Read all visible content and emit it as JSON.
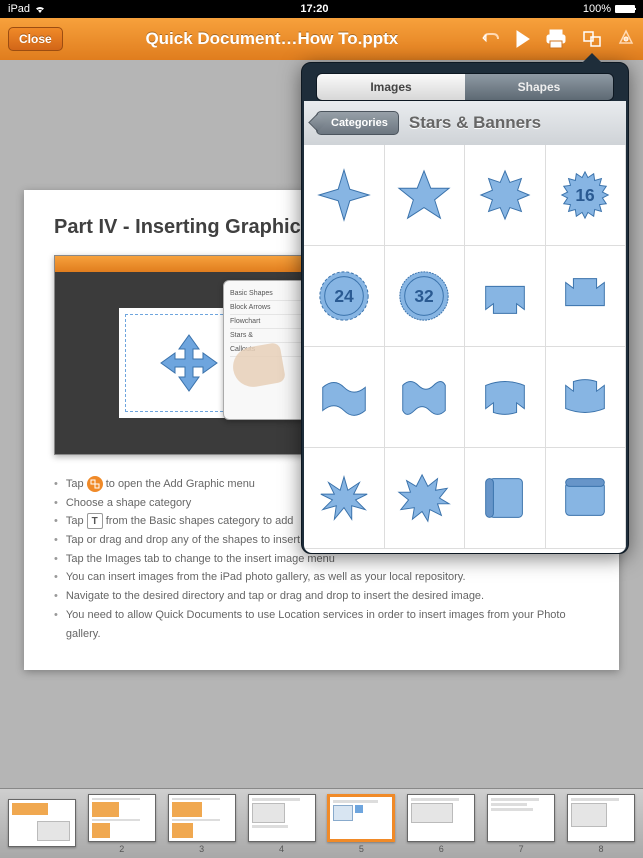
{
  "status": {
    "device": "iPad",
    "time": "17:20",
    "battery": "100%"
  },
  "toolbar": {
    "close": "Close",
    "title": "Quick Document…How To.pptx"
  },
  "slide": {
    "heading": "Part IV - Inserting Graphics",
    "mini_menu": [
      "Basic Shapes",
      "Block Arrows",
      "Flowchart",
      "Stars &",
      "Callouts"
    ],
    "bullets": [
      "Tap        to open the Add Graphic menu",
      "Choose a shape category",
      "Tap   T   from the Basic shapes category to add",
      "Tap or drag and drop any of the shapes to insert one of them",
      "Tap the Images tab to change to the insert image menu",
      "You can insert images from the iPad photo gallery, as well as your local repository.",
      "Navigate to the desired directory and tap or drag and drop to insert the desired image.",
      "You need to allow Quick Documents  to use Location services in order  to insert images from your Photo gallery."
    ]
  },
  "popover": {
    "tabs": {
      "images": "Images",
      "shapes": "Shapes"
    },
    "back": "Categories",
    "category": "Stars & Banners",
    "badges": {
      "r1c4": "16",
      "r2c1": "24",
      "r2c2": "32"
    }
  },
  "thumbs": {
    "count": 8,
    "active": 4,
    "labels": [
      "",
      "2",
      "3",
      "4",
      "5",
      "6",
      "7",
      "8"
    ]
  }
}
